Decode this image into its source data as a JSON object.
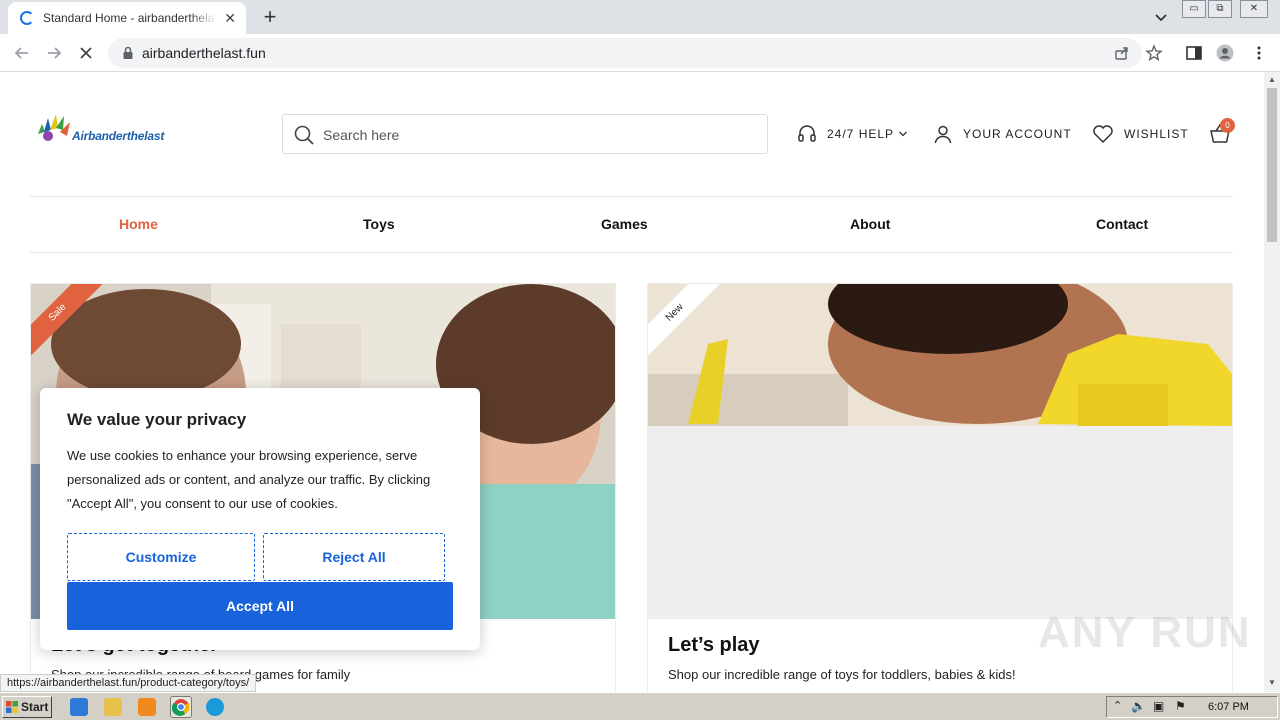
{
  "browser": {
    "tab_title": "Standard Home - airbanderthelast.fun",
    "tab_close": "✕",
    "new_tab": "+",
    "url": "airbanderthelast.fun",
    "window_controls": [
      "▭",
      "⧉",
      "✕"
    ]
  },
  "site": {
    "logo_text": "Airbanderthelast",
    "search_placeholder": "Search here",
    "help_label": "24/7 HELP",
    "account_label": "YOUR ACCOUNT",
    "wishlist_label": "WISHLIST",
    "cart_count": "0",
    "nav": [
      "Home",
      "Toys",
      "Games",
      "About",
      "Contact"
    ],
    "cards": [
      {
        "ribbon": "Sale",
        "title": "Let’s get together",
        "desc": "Shop our incredible range of board games for family"
      },
      {
        "ribbon": "New",
        "title": "Let’s play",
        "desc": "Shop our incredible range of toys for toddlers, babies & kids!"
      }
    ],
    "accent": "#e0623e"
  },
  "cookie": {
    "title": "We value your privacy",
    "body": "We use cookies to enhance your browsing experience, serve personalized ads or content, and analyze our traffic. By clicking \"Accept All\", you consent to our use of cookies.",
    "customize": "Customize",
    "reject": "Reject All",
    "accept": "Accept All",
    "accent": "#1863dc"
  },
  "status_bar_url": "https://airbanderthelast.fun/product-category/toys/",
  "watermark": "ANY RUN",
  "taskbar": {
    "start": "Start",
    "clock": "6:07 PM"
  }
}
